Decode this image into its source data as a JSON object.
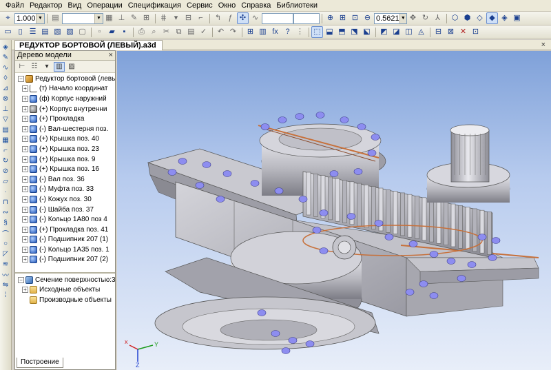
{
  "menu": [
    {
      "label": "Файл"
    },
    {
      "label": "Редактор"
    },
    {
      "label": "Вид"
    },
    {
      "label": "Операции"
    },
    {
      "label": "Спецификация"
    },
    {
      "label": "Сервис"
    },
    {
      "label": "Окно"
    },
    {
      "label": "Справка"
    },
    {
      "label": "Библиотеки"
    }
  ],
  "toolbar": {
    "step_value": "1.000",
    "zoom_value": "0.5621"
  },
  "document": {
    "tab_title": "РЕДУКТОР БОРТОВОЙ (ЛЕВЫЙ).a3d",
    "close_glyph": "×"
  },
  "tree_panel": {
    "title": "Дерево модели",
    "close_glyph": "×",
    "root": "Редуктор бортовой (левы",
    "items": [
      {
        "label": "(т) Начало координат",
        "icon": "origin-icon"
      },
      {
        "label": "(ф) Корпус наружний",
        "icon": "part-icon"
      },
      {
        "label": "(+) Корпус внутренни",
        "icon": "gray-part-icon"
      },
      {
        "label": "(+) Прокладка",
        "icon": "part-icon"
      },
      {
        "label": "(-) Вал-шестерня поз.",
        "icon": "part-icon"
      },
      {
        "label": "(+) Крышка поз. 40",
        "icon": "part-icon"
      },
      {
        "label": "(+) Крышка поз. 23",
        "icon": "part-icon"
      },
      {
        "label": "(+) Крышка поз. 9",
        "icon": "part-icon"
      },
      {
        "label": "(+) Крышка поз. 16",
        "icon": "part-icon"
      },
      {
        "label": "(-) Вал поз. 36",
        "icon": "part-icon"
      },
      {
        "label": "(-) Муфта поз. 33",
        "icon": "part-icon"
      },
      {
        "label": "(-) Кожух поз. 30",
        "icon": "part-icon"
      },
      {
        "label": "(-) Шайба поз. 37",
        "icon": "part-icon"
      },
      {
        "label": "(-) Кольцо 1А80 поз 4",
        "icon": "part-icon"
      },
      {
        "label": "(+) Прокладка поз. 41",
        "icon": "part-icon"
      },
      {
        "label": "(-) Подшипник 207 (1)",
        "icon": "part-icon"
      },
      {
        "label": "(-) Кольцо 1А35 поз. 1",
        "icon": "part-icon"
      },
      {
        "label": "(-) Подшипник 207 (2)",
        "icon": "part-icon"
      }
    ],
    "section": {
      "title": "Сечение поверхностью:3",
      "children": [
        "Исходные объекты",
        "Производные объекты"
      ]
    },
    "bottom_tab": "Построение"
  },
  "axes": {
    "x": "x",
    "y": "Y",
    "z": "Z"
  },
  "colors": {
    "viewport_top": "#7fa1d9",
    "viewport_bottom": "#e8eef9",
    "part_gray": "#b8b8be",
    "bolt_blue": "#8d8df0",
    "gasket_copper": "#c7703a"
  }
}
